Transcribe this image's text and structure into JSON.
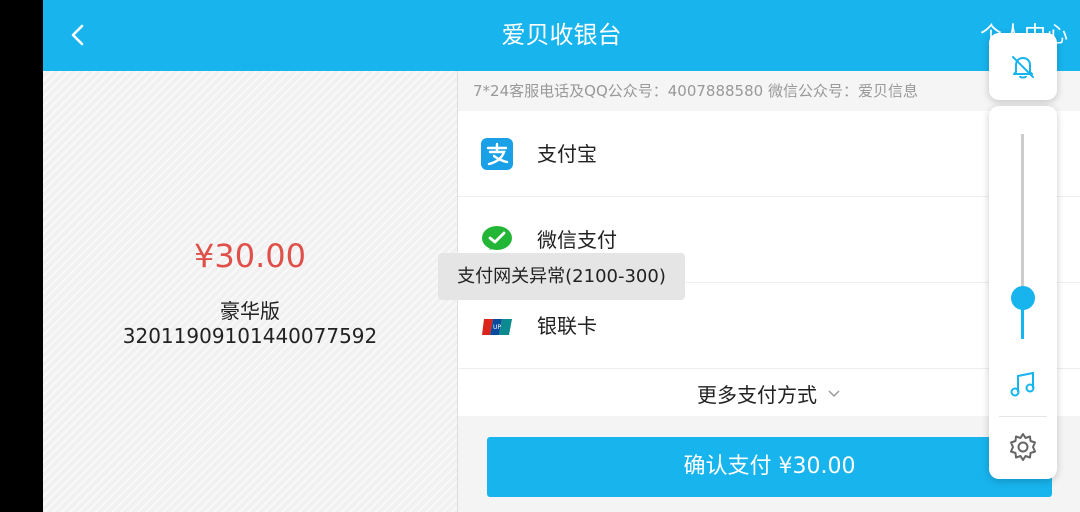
{
  "header": {
    "title": "爱贝收银台",
    "right_label": "个人中心"
  },
  "order": {
    "amount": "¥30.00",
    "plan": "豪华版",
    "order_id": "32011909101440077592"
  },
  "service_line": "7*24客服电话及QQ公众号：4007888580 微信公众号：爱贝信息",
  "payment_methods": [
    {
      "label": "支付宝",
      "icon": "alipay-icon"
    },
    {
      "label": "微信支付",
      "icon": "wechat-pay-icon"
    },
    {
      "label": "银联卡",
      "icon": "unionpay-icon"
    }
  ],
  "more_methods": "更多支付方式",
  "confirm_button": "确认支付 ¥30.00",
  "toast": "支付网关异常(2100-300)",
  "volume": {
    "level": 0.2,
    "icons": [
      "bell-off-icon",
      "music-note-icon",
      "gear-icon"
    ]
  },
  "colors": {
    "accent": "#18b4ee",
    "price": "#e0504a"
  }
}
